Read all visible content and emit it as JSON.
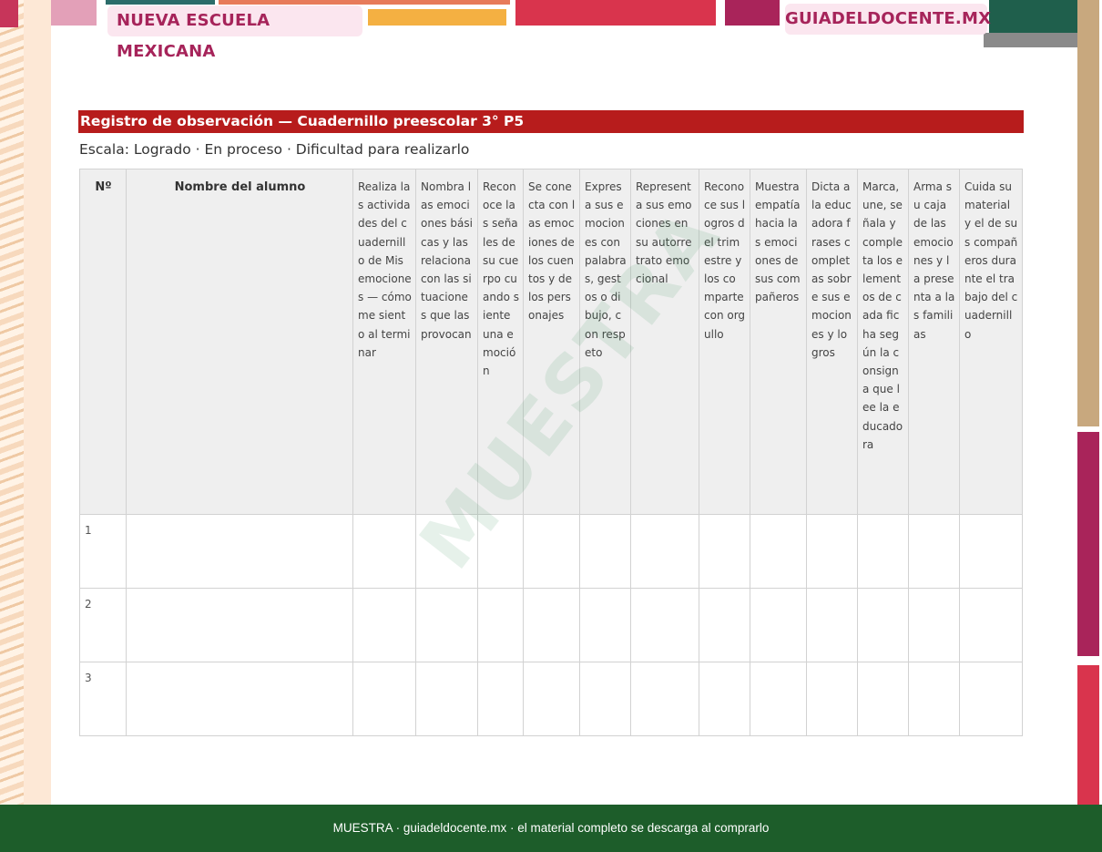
{
  "header": {
    "left_pill": "NUEVA ESCUELA MEXICANA",
    "right_pill": "GUIADELDOCENTE.MX"
  },
  "document": {
    "title": "Registro de observación — Cuadernillo preescolar 3° P5",
    "scale": "Escala: Logrado · En proceso · Dificultad para realizarlo"
  },
  "table": {
    "headers": [
      "Nº",
      "Nombre del alumno",
      "Realiza las actividades del cuadernillo de Mis emociones — cómo me siento al terminar",
      "Nombra las emociones básicas y las relaciona con las situaciones que las provocan",
      "Reconoce las señales de su cuerpo cuando siente una emoción",
      "Se conecta con las emociones de los cuentos y de los personajes",
      "Expresa sus emociones con palabras, gestos o dibujo, con respeto",
      "Representa sus emociones en su autorretrato emocional",
      "Reconoce sus logros del trimestre y los comparte con orgullo",
      "Muestra empatía hacia las emociones de sus compañeros",
      "Dicta a la educadora frases completas sobre sus emociones y logros",
      "Marca, une, señala y completa los elementos de cada ficha según la consigna que lee la educadora",
      "Arma su caja de las emociones y la presenta a las familias",
      "Cuida su material y el de sus compañeros durante el trabajo del cuadernillo"
    ],
    "rows": [
      {
        "num": "1",
        "name": ""
      },
      {
        "num": "2",
        "name": ""
      },
      {
        "num": "3",
        "name": ""
      }
    ]
  },
  "watermark": "MUESTRA",
  "footer": {
    "text": "MUESTRA · guiadeldocente.mx · el material completo se descarga al comprarlo"
  },
  "colors": {
    "title_bar": "#b71c1c",
    "footer": "#1d5d2a",
    "pill_text": "#a6245a",
    "pill_bg": "#fbe6ef",
    "header_cell": "#efefef"
  }
}
